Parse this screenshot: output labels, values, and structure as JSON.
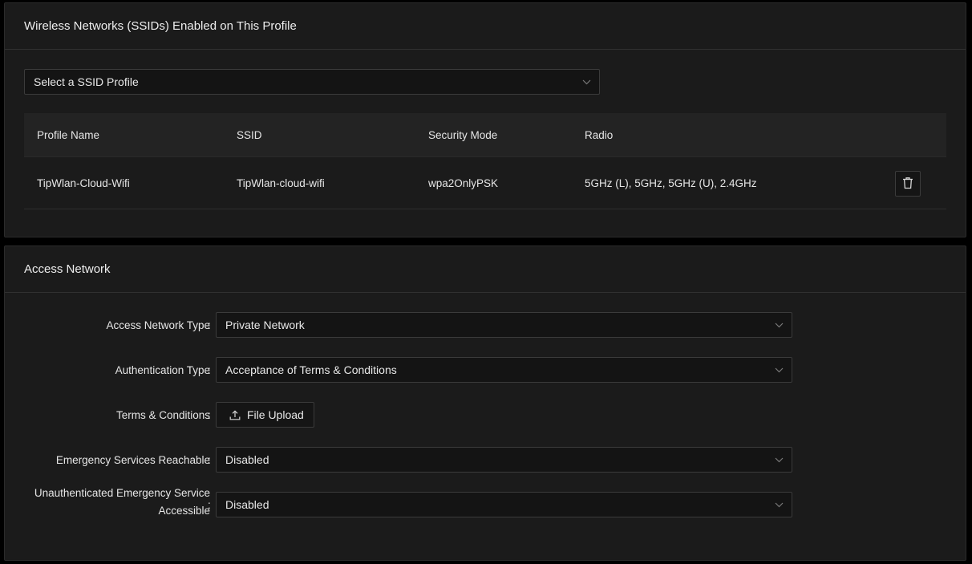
{
  "ssid_card": {
    "title": "Wireless Networks (SSIDs) Enabled on This Profile",
    "select_placeholder": "Select a SSID Profile",
    "table": {
      "headers": [
        "Profile Name",
        "SSID",
        "Security Mode",
        "Radio"
      ],
      "rows": [
        {
          "profile_name": "TipWlan-Cloud-Wifi",
          "ssid": "TipWlan-cloud-wifi",
          "security_mode": "wpa2OnlyPSK",
          "radio": "5GHz (L), 5GHz, 5GHz (U), 2.4GHz",
          "action_icon": "trash-icon"
        }
      ]
    }
  },
  "access_card": {
    "title": "Access Network",
    "fields": {
      "access_network_type": {
        "label": "Access Network Type",
        "value": "Private Network"
      },
      "authentication_type": {
        "label": "Authentication Type",
        "value": "Acceptance of Terms & Conditions"
      },
      "terms_conditions": {
        "label": "Terms & Conditions",
        "button": "File Upload",
        "icon": "upload-icon"
      },
      "emergency_reachable": {
        "label": "Emergency Services Reachable",
        "value": "Disabled"
      },
      "unauth_emergency": {
        "label_line1": "Unauthenticated Emergency Service",
        "label_line2": "Accessible",
        "value": "Disabled"
      }
    },
    "colon": ":"
  },
  "colors": {
    "background": "#000000",
    "card": "#1b1b1b",
    "table_header": "#232323",
    "border": "#3b3b3b",
    "text": "#e6e6e6"
  }
}
